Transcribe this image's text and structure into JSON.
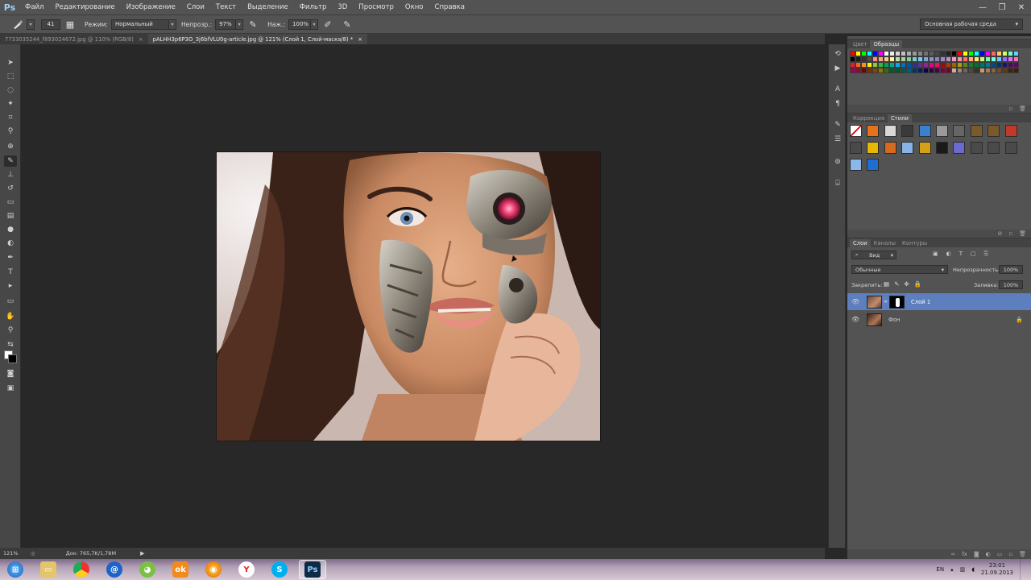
{
  "app": {
    "logo": "Ps"
  },
  "menu": [
    "Файл",
    "Редактирование",
    "Изображение",
    "Слои",
    "Текст",
    "Выделение",
    "Фильтр",
    "3D",
    "Просмотр",
    "Окно",
    "Справка"
  ],
  "window_controls": {
    "minimize": "—",
    "restore": "❐",
    "close": "✕"
  },
  "options": {
    "brush_size": "41",
    "mode_label": "Режим:",
    "mode_value": "Нормальный",
    "opacity_label": "Непрозр.:",
    "opacity_value": "97%",
    "pressure_label": "Наж.:",
    "pressure_value": "100%",
    "workspace": "Основная рабочая среда"
  },
  "tabs": [
    {
      "label": "7733035244_f893024672.jpg @ 110% (RGB/8)",
      "close": "×"
    },
    {
      "label": "pALHH3p6P3O_3j6bfVLU0g-article.jpg @ 121% (Слой 1, Слой-маска/8) *",
      "close": "×"
    }
  ],
  "status": {
    "zoom": "121%",
    "doc": "Док: 765,7K/1,78M"
  },
  "swatches_panel": {
    "tab_color": "Цвет",
    "tab_swatches": "Образцы"
  },
  "styles_panel": {
    "tab_adjust": "Коррекция",
    "tab_styles": "Стили"
  },
  "layers_panel": {
    "tab_layers": "Слои",
    "tab_channels": "Каналы",
    "tab_paths": "Контуры",
    "filter_kind": "Вид",
    "blend_mode": "Обычные",
    "opacity_label": "Непрозрачность:",
    "opacity_value": "100%",
    "lock_label": "Закрепить:",
    "fill_label": "Заливка:",
    "fill_value": "100%",
    "layers": [
      {
        "name": "Слой 1"
      },
      {
        "name": "Фон"
      }
    ]
  },
  "taskbar": {
    "lang": "EN",
    "time": "23:01",
    "date": "21.09.2013"
  },
  "colors": {
    "accent_selected_layer": "#5d7fbe",
    "chrome": "#535353",
    "canvas_bg": "#282828"
  }
}
